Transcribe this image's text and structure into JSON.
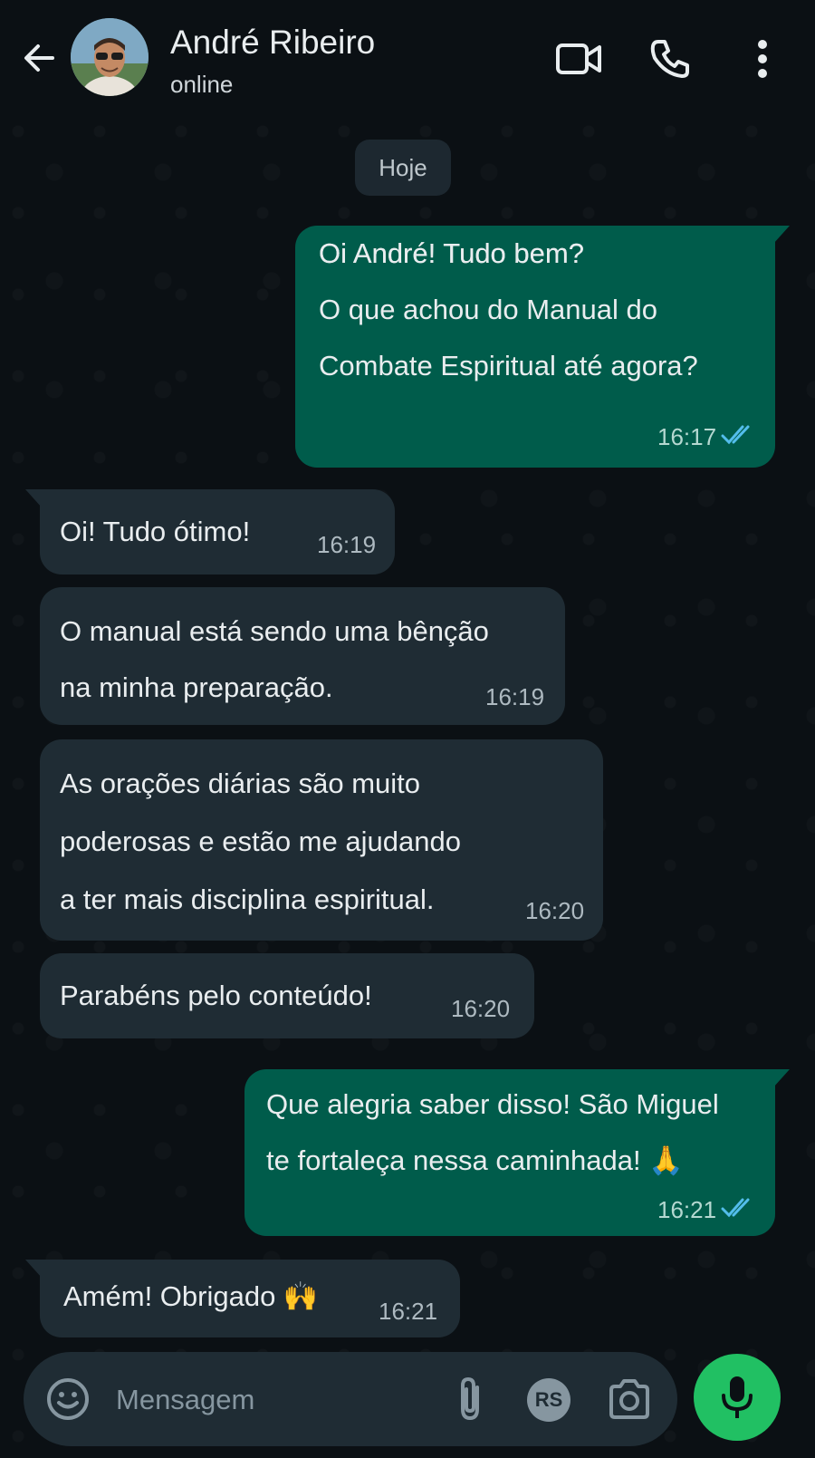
{
  "header": {
    "contact_name": "André Ribeiro",
    "status": "online",
    "icons": [
      "back-arrow-icon",
      "avatar",
      "video-call-icon",
      "voice-call-icon",
      "more-options-icon"
    ]
  },
  "date_chip": "Hoje",
  "messages": [
    {
      "direction": "out",
      "lines": [
        "Oi André! Tudo bem?",
        "O que achou do Manual do",
        "Combate Espiritual até agora?"
      ],
      "time": "16:17",
      "status": "read"
    },
    {
      "direction": "in",
      "lines": [
        "Oi! Tudo ótimo!"
      ],
      "time": "16:19"
    },
    {
      "direction": "in",
      "lines": [
        "O manual está sendo uma bênção",
        "na minha preparação."
      ],
      "time": "16:19"
    },
    {
      "direction": "in",
      "lines": [
        "As orações diárias são muito",
        "poderosas e estão me ajudando",
        "a ter mais disciplina espiritual."
      ],
      "time": "16:20"
    },
    {
      "direction": "in",
      "lines": [
        "Parabéns pelo conteúdo!"
      ],
      "time": "16:20"
    },
    {
      "direction": "out",
      "lines": [
        "Que alegria saber disso! São Miguel",
        "te fortaleça nessa caminhada! 🙏"
      ],
      "time": "16:21",
      "status": "read"
    },
    {
      "direction": "in",
      "lines": [
        "Amém! Obrigado 🙌"
      ],
      "time": "16:21"
    }
  ],
  "composer": {
    "placeholder": "Mensagem",
    "rs_badge": "RS",
    "icons": [
      "emoji-icon",
      "attach-icon",
      "rs-icon",
      "camera-icon",
      "microphone-icon"
    ]
  },
  "colors": {
    "background": "#0b1014",
    "incoming_bubble": "#1f2c34",
    "outgoing_bubble": "#005c4b",
    "read_ticks": "#53bdeb",
    "mic_button": "#21c063"
  }
}
